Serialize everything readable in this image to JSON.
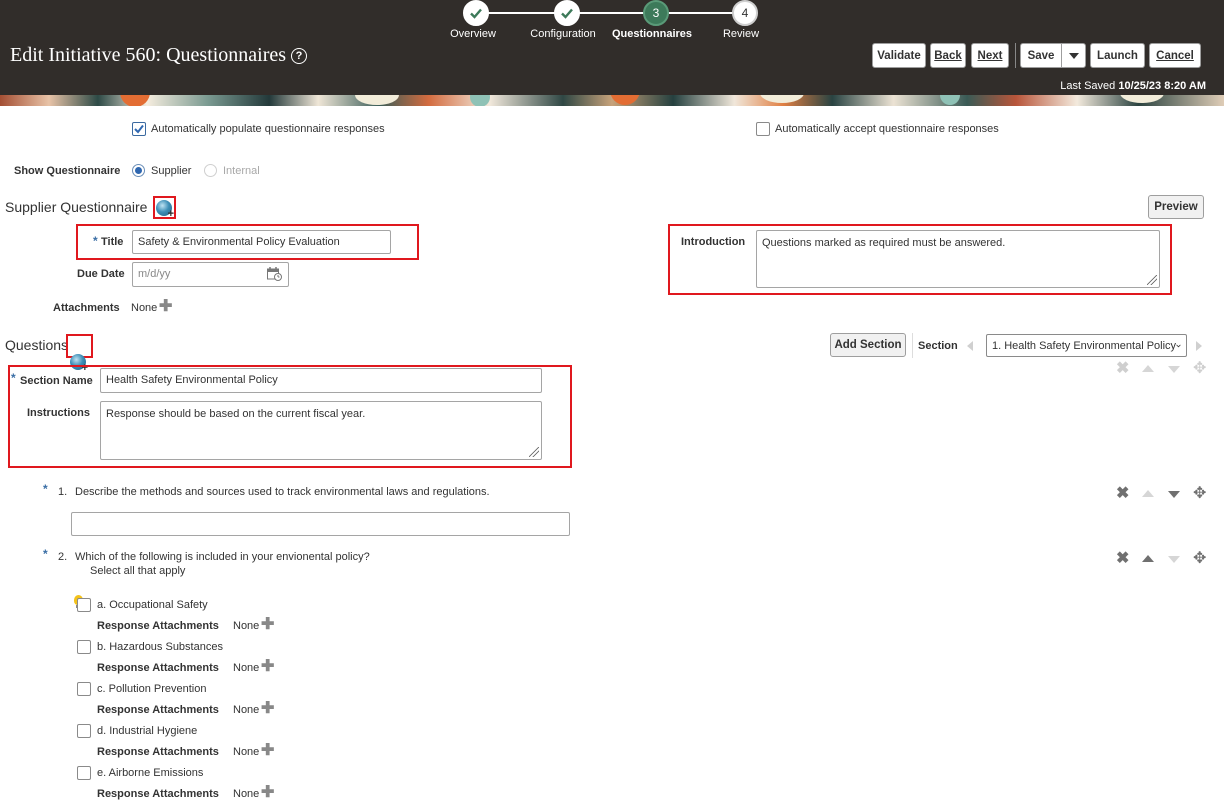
{
  "header": {
    "title": "Edit Initiative 560: Questionnaires",
    "help_icon": "?",
    "train": [
      {
        "label": "Overview",
        "state": "done",
        "marker": ""
      },
      {
        "label": "Configuration",
        "state": "done",
        "marker": ""
      },
      {
        "label": "Questionnaires",
        "state": "current",
        "marker": "3"
      },
      {
        "label": "Review",
        "state": "todo",
        "marker": "4"
      }
    ],
    "buttons": {
      "validate": "Validate",
      "back": "Back",
      "next": "Next",
      "save": "Save",
      "launch": "Launch",
      "cancel": "Cancel"
    },
    "last_saved_label": "Last Saved",
    "last_saved_value": "10/25/23 8:20 AM"
  },
  "options": {
    "auto_populate": "Automatically populate questionnaire responses",
    "auto_populate_checked": true,
    "auto_accept": "Automatically accept questionnaire responses",
    "auto_accept_checked": false,
    "show_questionnaire_label": "Show Questionnaire",
    "show_supplier": "Supplier",
    "show_internal": "Internal"
  },
  "supplier_questionnaire": {
    "heading": "Supplier Questionnaire",
    "preview": "Preview",
    "title_label": "Title",
    "required_mark": "*",
    "title_value": "Safety & Environmental Policy Evaluation",
    "due_date_label": "Due Date",
    "due_date_placeholder": "m/d/yy",
    "attachments_label": "Attachments",
    "attachments_value": "None",
    "introduction_label": "Introduction",
    "introduction_value": "Questions marked as required must be answered."
  },
  "questions": {
    "heading": "Questions",
    "add_section": "Add Section",
    "section_label": "Section",
    "section_selected": "1. Health Safety Environmental Policy",
    "section_name_label": "Section Name",
    "section_name_value": "Health Safety Environmental Policy",
    "instructions_label": "Instructions",
    "instructions_value": "Response should be based on the current fiscal year.",
    "q1": {
      "number": "1.",
      "text": "Describe the methods and sources used to track environmental laws and regulations.",
      "response": ""
    },
    "q2": {
      "number": "2.",
      "text": "Which of the following is included in your envionental policy?",
      "hint": "Select all that apply",
      "response_attachments_label": "Response Attachments",
      "none": "None",
      "options": [
        "a. Occupational Safety",
        "b. Hazardous Substances",
        "c. Pollution Prevention",
        "d. Industrial Hygiene",
        "e. Airborne Emissions"
      ]
    }
  },
  "colors": {
    "header_bg": "#312d2a",
    "current_step": "#3d7a5a",
    "highlight_box": "#e0181e",
    "required_star": "#3a6ea5"
  }
}
